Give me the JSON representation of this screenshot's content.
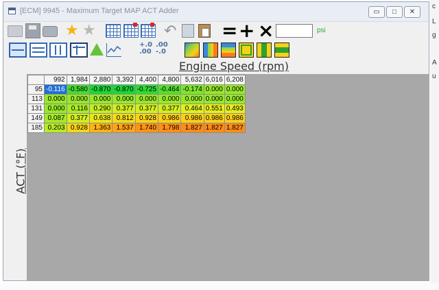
{
  "window": {
    "title": "[ECM] 9945 - Maximum Target MAP ACT Adder",
    "controls": [
      "minimize",
      "maximize",
      "close"
    ]
  },
  "toolbar": {
    "ops": [
      "=",
      "+",
      "×"
    ],
    "value_input": "",
    "unit": "psi",
    "decimals_increase": "+.0 .00",
    "decimals_decrease": ".00 -.0"
  },
  "axes": {
    "x_label": "Engine Speed (rpm)",
    "y_label": "ACT (°F)"
  },
  "table": {
    "columns": [
      "992",
      "1,984",
      "2,880",
      "3,392",
      "4,400",
      "4,800",
      "5,632",
      "6,016",
      "6,208"
    ],
    "rows": [
      {
        "label": "95",
        "values": [
          "-0.116",
          "-0.580",
          "-0.870",
          "-0.870",
          "-0.725",
          "-0.464",
          "-0.174",
          "0.000",
          "0.000"
        ]
      },
      {
        "label": "113",
        "values": [
          "0.000",
          "0.000",
          "0.000",
          "0.000",
          "0.000",
          "0.000",
          "0.000",
          "0.000",
          "0.000"
        ]
      },
      {
        "label": "131",
        "values": [
          "0.000",
          "0.116",
          "0.290",
          "0.377",
          "0.377",
          "0.377",
          "0.464",
          "0.551",
          "0.493"
        ]
      },
      {
        "label": "149",
        "values": [
          "0.087",
          "0.377",
          "0.638",
          "0.812",
          "0.928",
          "0.986",
          "0.986",
          "0.986",
          "0.986"
        ]
      },
      {
        "label": "185",
        "values": [
          "0.203",
          "0.928",
          "1.363",
          "1.537",
          "1.740",
          "1.798",
          "1.827",
          "1.827",
          "1.827"
        ]
      }
    ],
    "selected_cell": [
      0,
      0
    ]
  },
  "colors": {
    "selected": "#1f6fd6",
    "grey": "#a8a8a8"
  },
  "background": {
    "fragments": [
      "c",
      "L",
      "g",
      "A",
      "u"
    ]
  }
}
